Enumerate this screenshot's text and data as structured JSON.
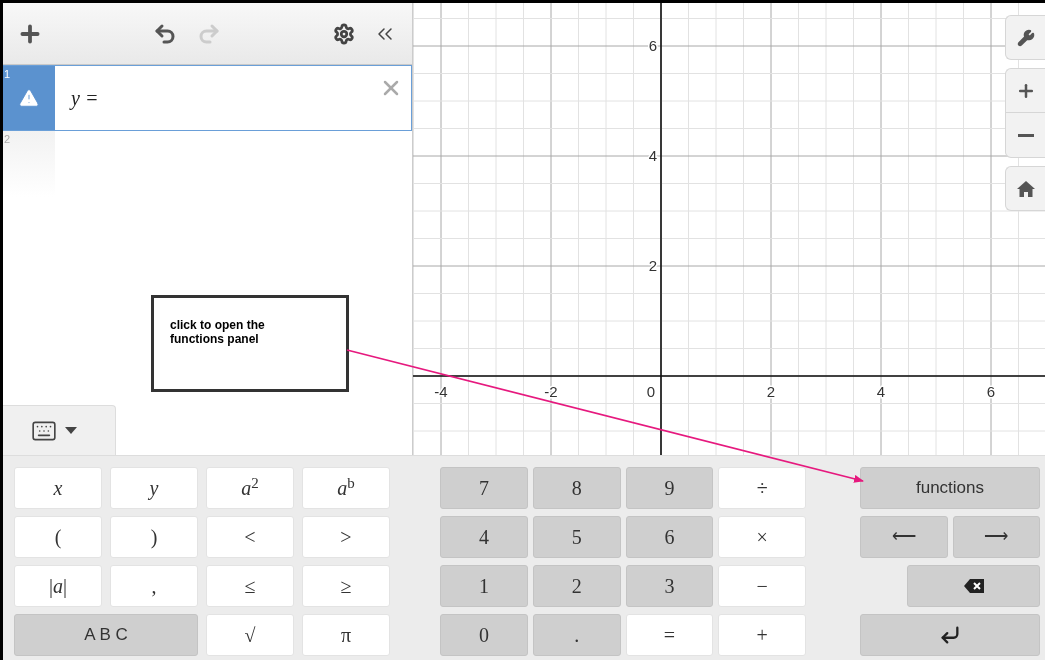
{
  "toolbar": {
    "undo": {
      "disabled": false
    },
    "redo": {
      "disabled": true
    }
  },
  "expressions": [
    {
      "number": "1",
      "text": "y =",
      "selected": true,
      "warning": true
    },
    {
      "number": "2",
      "selected": false,
      "warning": false
    }
  ],
  "graph": {
    "x_ticks": [
      "-4",
      "-2",
      "0",
      "2",
      "4",
      "6"
    ],
    "y_ticks": [
      "6",
      "4",
      "2"
    ]
  },
  "keyboard_toggle": {
    "expanded": true
  },
  "callout": {
    "text": "click to open the functions panel"
  },
  "keypad": {
    "groups": [
      {
        "keys": [
          {
            "label": "x",
            "kind": "light",
            "italic": true
          },
          {
            "label": "y",
            "kind": "light",
            "italic": true
          },
          {
            "label": "*a*$^{2}$",
            "kind": "light"
          },
          {
            "label": "*a*$^{b}$",
            "kind": "light"
          },
          {
            "label": "(",
            "kind": "light"
          },
          {
            "label": ")",
            "kind": "light"
          },
          {
            "label": "<",
            "kind": "light"
          },
          {
            "label": ">",
            "kind": "light"
          },
          {
            "label": "|*a*|",
            "kind": "light"
          },
          {
            "label": ",",
            "kind": "light"
          },
          {
            "label": "≤",
            "kind": "light"
          },
          {
            "label": "≥",
            "kind": "light"
          },
          {
            "label": "A B C",
            "kind": "dark",
            "wide": true,
            "sans": true
          },
          {
            "label": "√",
            "kind": "light"
          },
          {
            "label": "π",
            "kind": "light"
          }
        ]
      },
      {
        "keys": [
          {
            "label": "7",
            "kind": "dark"
          },
          {
            "label": "8",
            "kind": "dark"
          },
          {
            "label": "9",
            "kind": "dark"
          },
          {
            "label": "÷",
            "kind": "light"
          },
          {
            "label": "4",
            "kind": "dark"
          },
          {
            "label": "5",
            "kind": "dark"
          },
          {
            "label": "6",
            "kind": "dark"
          },
          {
            "label": "×",
            "kind": "light"
          },
          {
            "label": "1",
            "kind": "dark"
          },
          {
            "label": "2",
            "kind": "dark"
          },
          {
            "label": "3",
            "kind": "dark"
          },
          {
            "label": "−",
            "kind": "light"
          },
          {
            "label": "0",
            "kind": "dark"
          },
          {
            "label": ".",
            "kind": "dark"
          },
          {
            "label": "=",
            "kind": "light"
          },
          {
            "label": "+",
            "kind": "light"
          }
        ]
      },
      {
        "keys": [
          {
            "label": "functions",
            "kind": "dark",
            "wide": true,
            "sans": true
          },
          {
            "label": "⟵",
            "kind": "dark",
            "sans": true
          },
          {
            "label": "⟶",
            "kind": "dark",
            "sans": true
          },
          {
            "kind": "backspace"
          },
          {
            "kind": "enter"
          }
        ]
      }
    ]
  }
}
